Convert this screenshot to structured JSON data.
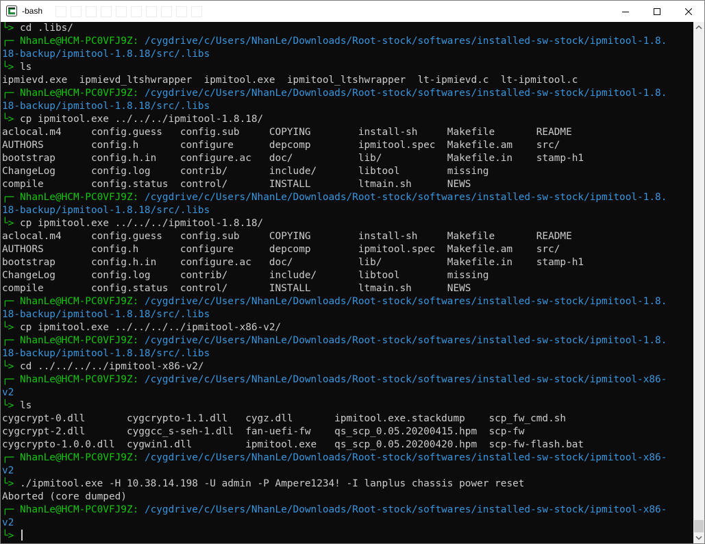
{
  "window": {
    "title": "-bash"
  },
  "prompt": {
    "corner_top": "┌─ ",
    "corner_bottom": "└> ",
    "user_host": "NhanLe@HCM-PC0VFJ9Z",
    "colon": ": "
  },
  "lines": [
    {
      "t": "cmd",
      "text": "cd .libs/"
    },
    {
      "t": "path",
      "text": "/cygdrive/c/Users/NhanLe/Downloads/Root-stock/softwares/installed-sw-stock/ipmitool-1.8."
    },
    {
      "t": "cont",
      "text": "18-backup/ipmitool-1.8.18/src/.libs"
    },
    {
      "t": "cmd",
      "text": "ls"
    },
    {
      "t": "out",
      "text": "ipmievd.exe  ipmievd_ltshwrapper  ipmitool.exe  ipmitool_ltshwrapper  lt-ipmievd.c  lt-ipmitool.c"
    },
    {
      "t": "path",
      "text": "/cygdrive/c/Users/NhanLe/Downloads/Root-stock/softwares/installed-sw-stock/ipmitool-1.8."
    },
    {
      "t": "cont",
      "text": "18-backup/ipmitool-1.8.18/src/.libs"
    },
    {
      "t": "cmd",
      "text": "cp ipmitool.exe ../../../ipmitool-1.8.18/"
    },
    {
      "t": "out",
      "text": "aclocal.m4     config.guess   config.sub     COPYING        install-sh     Makefile       README"
    },
    {
      "t": "out",
      "text": "AUTHORS        config.h       configure      depcomp        ipmitool.spec  Makefile.am    src/"
    },
    {
      "t": "out",
      "text": "bootstrap      config.h.in    configure.ac   doc/           lib/           Makefile.in    stamp-h1"
    },
    {
      "t": "out",
      "text": "ChangeLog      config.log     contrib/       include/       libtool        missing"
    },
    {
      "t": "out",
      "text": "compile        config.status  control/       INSTALL        ltmain.sh      NEWS"
    },
    {
      "t": "path",
      "text": "/cygdrive/c/Users/NhanLe/Downloads/Root-stock/softwares/installed-sw-stock/ipmitool-1.8."
    },
    {
      "t": "cont",
      "text": "18-backup/ipmitool-1.8.18/src/.libs"
    },
    {
      "t": "cmd",
      "text": "cp ipmitool.exe ../../../ipmitool-1.8.18/"
    },
    {
      "t": "out",
      "text": "aclocal.m4     config.guess   config.sub     COPYING        install-sh     Makefile       README"
    },
    {
      "t": "out",
      "text": "AUTHORS        config.h       configure      depcomp        ipmitool.spec  Makefile.am    src/"
    },
    {
      "t": "out",
      "text": "bootstrap      config.h.in    configure.ac   doc/           lib/           Makefile.in    stamp-h1"
    },
    {
      "t": "out",
      "text": "ChangeLog      config.log     contrib/       include/       libtool        missing"
    },
    {
      "t": "out",
      "text": "compile        config.status  control/       INSTALL        ltmain.sh      NEWS"
    },
    {
      "t": "path",
      "text": "/cygdrive/c/Users/NhanLe/Downloads/Root-stock/softwares/installed-sw-stock/ipmitool-1.8."
    },
    {
      "t": "cont",
      "text": "18-backup/ipmitool-1.8.18/src/.libs"
    },
    {
      "t": "cmd",
      "text": "cp ipmitool.exe ../../../../ipmitool-x86-v2/"
    },
    {
      "t": "path",
      "text": "/cygdrive/c/Users/NhanLe/Downloads/Root-stock/softwares/installed-sw-stock/ipmitool-1.8."
    },
    {
      "t": "cont",
      "text": "18-backup/ipmitool-1.8.18/src/.libs"
    },
    {
      "t": "cmd",
      "text": "cd ../../../../ipmitool-x86-v2/"
    },
    {
      "t": "path",
      "text": "/cygdrive/c/Users/NhanLe/Downloads/Root-stock/softwares/installed-sw-stock/ipmitool-x86-"
    },
    {
      "t": "cont",
      "text": "v2"
    },
    {
      "t": "cmd",
      "text": "ls"
    },
    {
      "t": "out",
      "text": "cygcrypt-0.dll       cygcrypto-1.1.dll   cygz.dll       ipmitool.exe.stackdump    scp_fw_cmd.sh"
    },
    {
      "t": "out",
      "text": "cygcrypt-2.dll       cyggcc_s-seh-1.dll  fan-uefi-fw    qs_scp_0.05.20200415.hpm  scp-fw"
    },
    {
      "t": "out",
      "text": "cygcrypto-1.0.0.dll  cygwin1.dll         ipmitool.exe   qs_scp_0.05.20200420.hpm  scp-fw-flash.bat"
    },
    {
      "t": "path",
      "text": "/cygdrive/c/Users/NhanLe/Downloads/Root-stock/softwares/installed-sw-stock/ipmitool-x86-"
    },
    {
      "t": "cont",
      "text": "v2"
    },
    {
      "t": "cmd",
      "text": "./ipmitool.exe -H 10.38.14.198 -U admin -P Ampere1234! -I lanplus chassis power reset"
    },
    {
      "t": "out",
      "text": "Aborted (core dumped)"
    },
    {
      "t": "path",
      "text": "/cygdrive/c/Users/NhanLe/Downloads/Root-stock/softwares/installed-sw-stock/ipmitool-x86-"
    },
    {
      "t": "cont",
      "text": "v2"
    },
    {
      "t": "input",
      "text": ""
    }
  ]
}
